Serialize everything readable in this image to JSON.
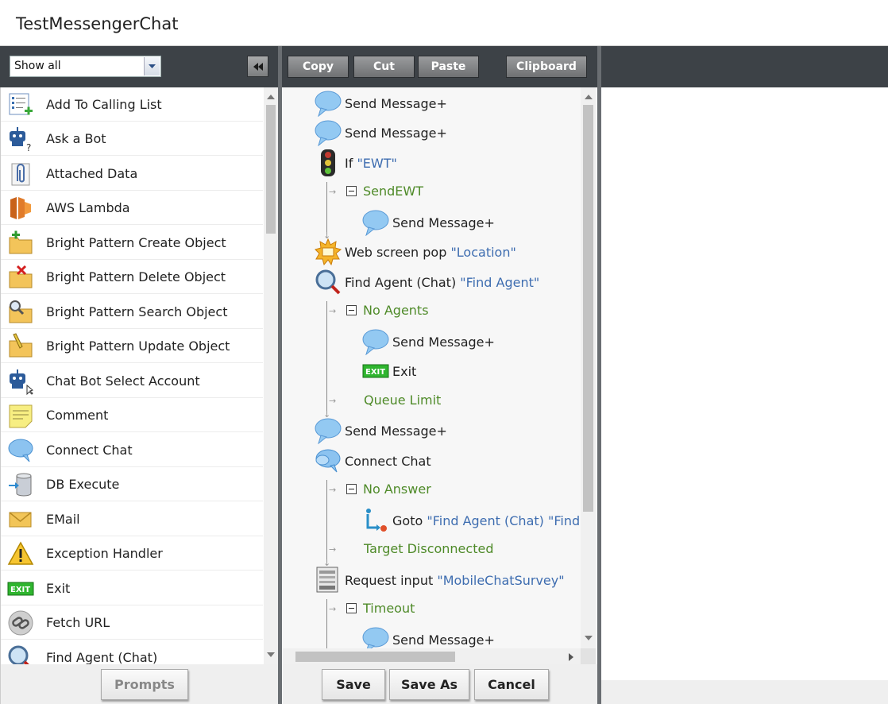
{
  "app": {
    "title": "TestMessengerChat"
  },
  "palette_filter": {
    "value": "Show all"
  },
  "toolbar": {
    "copy": "Copy",
    "cut": "Cut",
    "paste": "Paste",
    "clipboard": "Clipboard"
  },
  "palette": {
    "items": [
      {
        "label": "Add To Calling List",
        "icon": "calling-list-icon"
      },
      {
        "label": "Ask a Bot",
        "icon": "bot-question-icon"
      },
      {
        "label": "Attached Data",
        "icon": "paperclip-icon"
      },
      {
        "label": "AWS Lambda",
        "icon": "aws-lambda-icon"
      },
      {
        "label": "Bright Pattern Create Object",
        "icon": "folder-add-icon"
      },
      {
        "label": "Bright Pattern Delete Object",
        "icon": "folder-delete-icon"
      },
      {
        "label": "Bright Pattern Search Object",
        "icon": "folder-search-icon"
      },
      {
        "label": "Bright Pattern Update Object",
        "icon": "folder-edit-icon"
      },
      {
        "label": "Chat Bot Select Account",
        "icon": "bot-cursor-icon"
      },
      {
        "label": "Comment",
        "icon": "sticky-note-icon"
      },
      {
        "label": "Connect Chat",
        "icon": "chat-bubbles-icon"
      },
      {
        "label": "DB Execute",
        "icon": "database-icon"
      },
      {
        "label": "EMail",
        "icon": "envelope-icon"
      },
      {
        "label": "Exception Handler",
        "icon": "warning-icon"
      },
      {
        "label": "Exit",
        "icon": "exit-icon"
      },
      {
        "label": "Fetch URL",
        "icon": "link-icon"
      },
      {
        "label": "Find Agent (Chat)",
        "icon": "magnifier-icon"
      }
    ],
    "prompts_button": "Prompts"
  },
  "flow": {
    "steps": [
      {
        "name": "Send Message+",
        "param": ""
      },
      {
        "name": "Send Message+",
        "param": ""
      },
      {
        "name": "If ",
        "param": "\"EWT\""
      },
      {
        "name": "SendEWT",
        "param": ""
      },
      {
        "name": "Send Message+",
        "param": ""
      },
      {
        "name": "Web screen pop ",
        "param": "\"Location\""
      },
      {
        "name": "Find Agent (Chat) ",
        "param": "\"Find Agent\""
      },
      {
        "name": "No Agents",
        "param": ""
      },
      {
        "name": "Send Message+",
        "param": ""
      },
      {
        "name": "Exit",
        "param": ""
      },
      {
        "name": "Queue Limit",
        "param": ""
      },
      {
        "name": "Send Message+",
        "param": ""
      },
      {
        "name": "Connect Chat",
        "param": ""
      },
      {
        "name": "No Answer",
        "param": ""
      },
      {
        "name": "Goto ",
        "param": "\"Find Agent (Chat) \"Find A"
      },
      {
        "name": "Target Disconnected",
        "param": ""
      },
      {
        "name": "Request input ",
        "param": "\"MobileChatSurvey\""
      },
      {
        "name": "Timeout",
        "param": ""
      },
      {
        "name": "Send Message+",
        "param": ""
      }
    ]
  },
  "footer": {
    "save": "Save",
    "save_as": "Save As",
    "cancel": "Cancel"
  },
  "colors": {
    "toolbar": "#3d4247",
    "param_blue": "#3e6db0",
    "branch_green": "#4e8a28"
  }
}
